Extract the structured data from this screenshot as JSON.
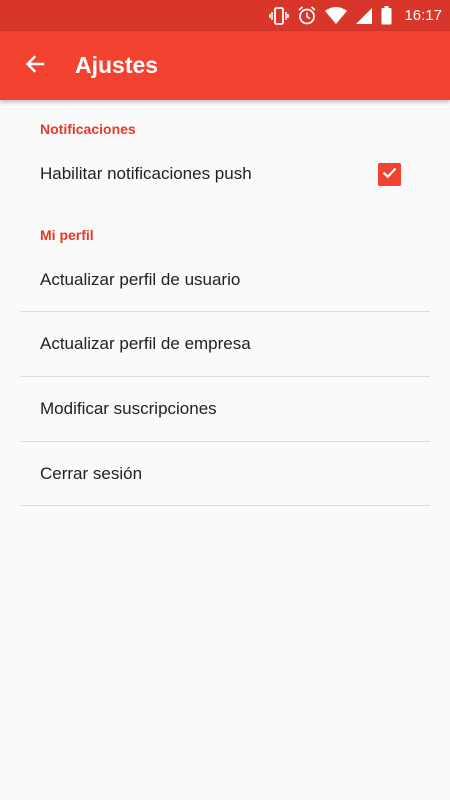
{
  "status_bar": {
    "time": "16:17",
    "icons": [
      "vibrate-icon",
      "alarm-icon",
      "wifi-icon",
      "signal-icon",
      "battery-icon"
    ]
  },
  "app_bar": {
    "back_icon": "arrow-left-icon",
    "title": "Ajustes"
  },
  "sections": {
    "notifications": {
      "header": "Notificaciones",
      "push_label": "Habilitar notificaciones push",
      "push_checked": true
    },
    "profile": {
      "header": "Mi perfil",
      "items": [
        "Actualizar perfil de usuario",
        "Actualizar perfil de empresa",
        "Modificar suscripciones",
        "Cerrar sesión"
      ]
    }
  },
  "colors": {
    "accent": "#f44230",
    "status_bar": "#d8362a",
    "section_header": "#e53a27"
  }
}
